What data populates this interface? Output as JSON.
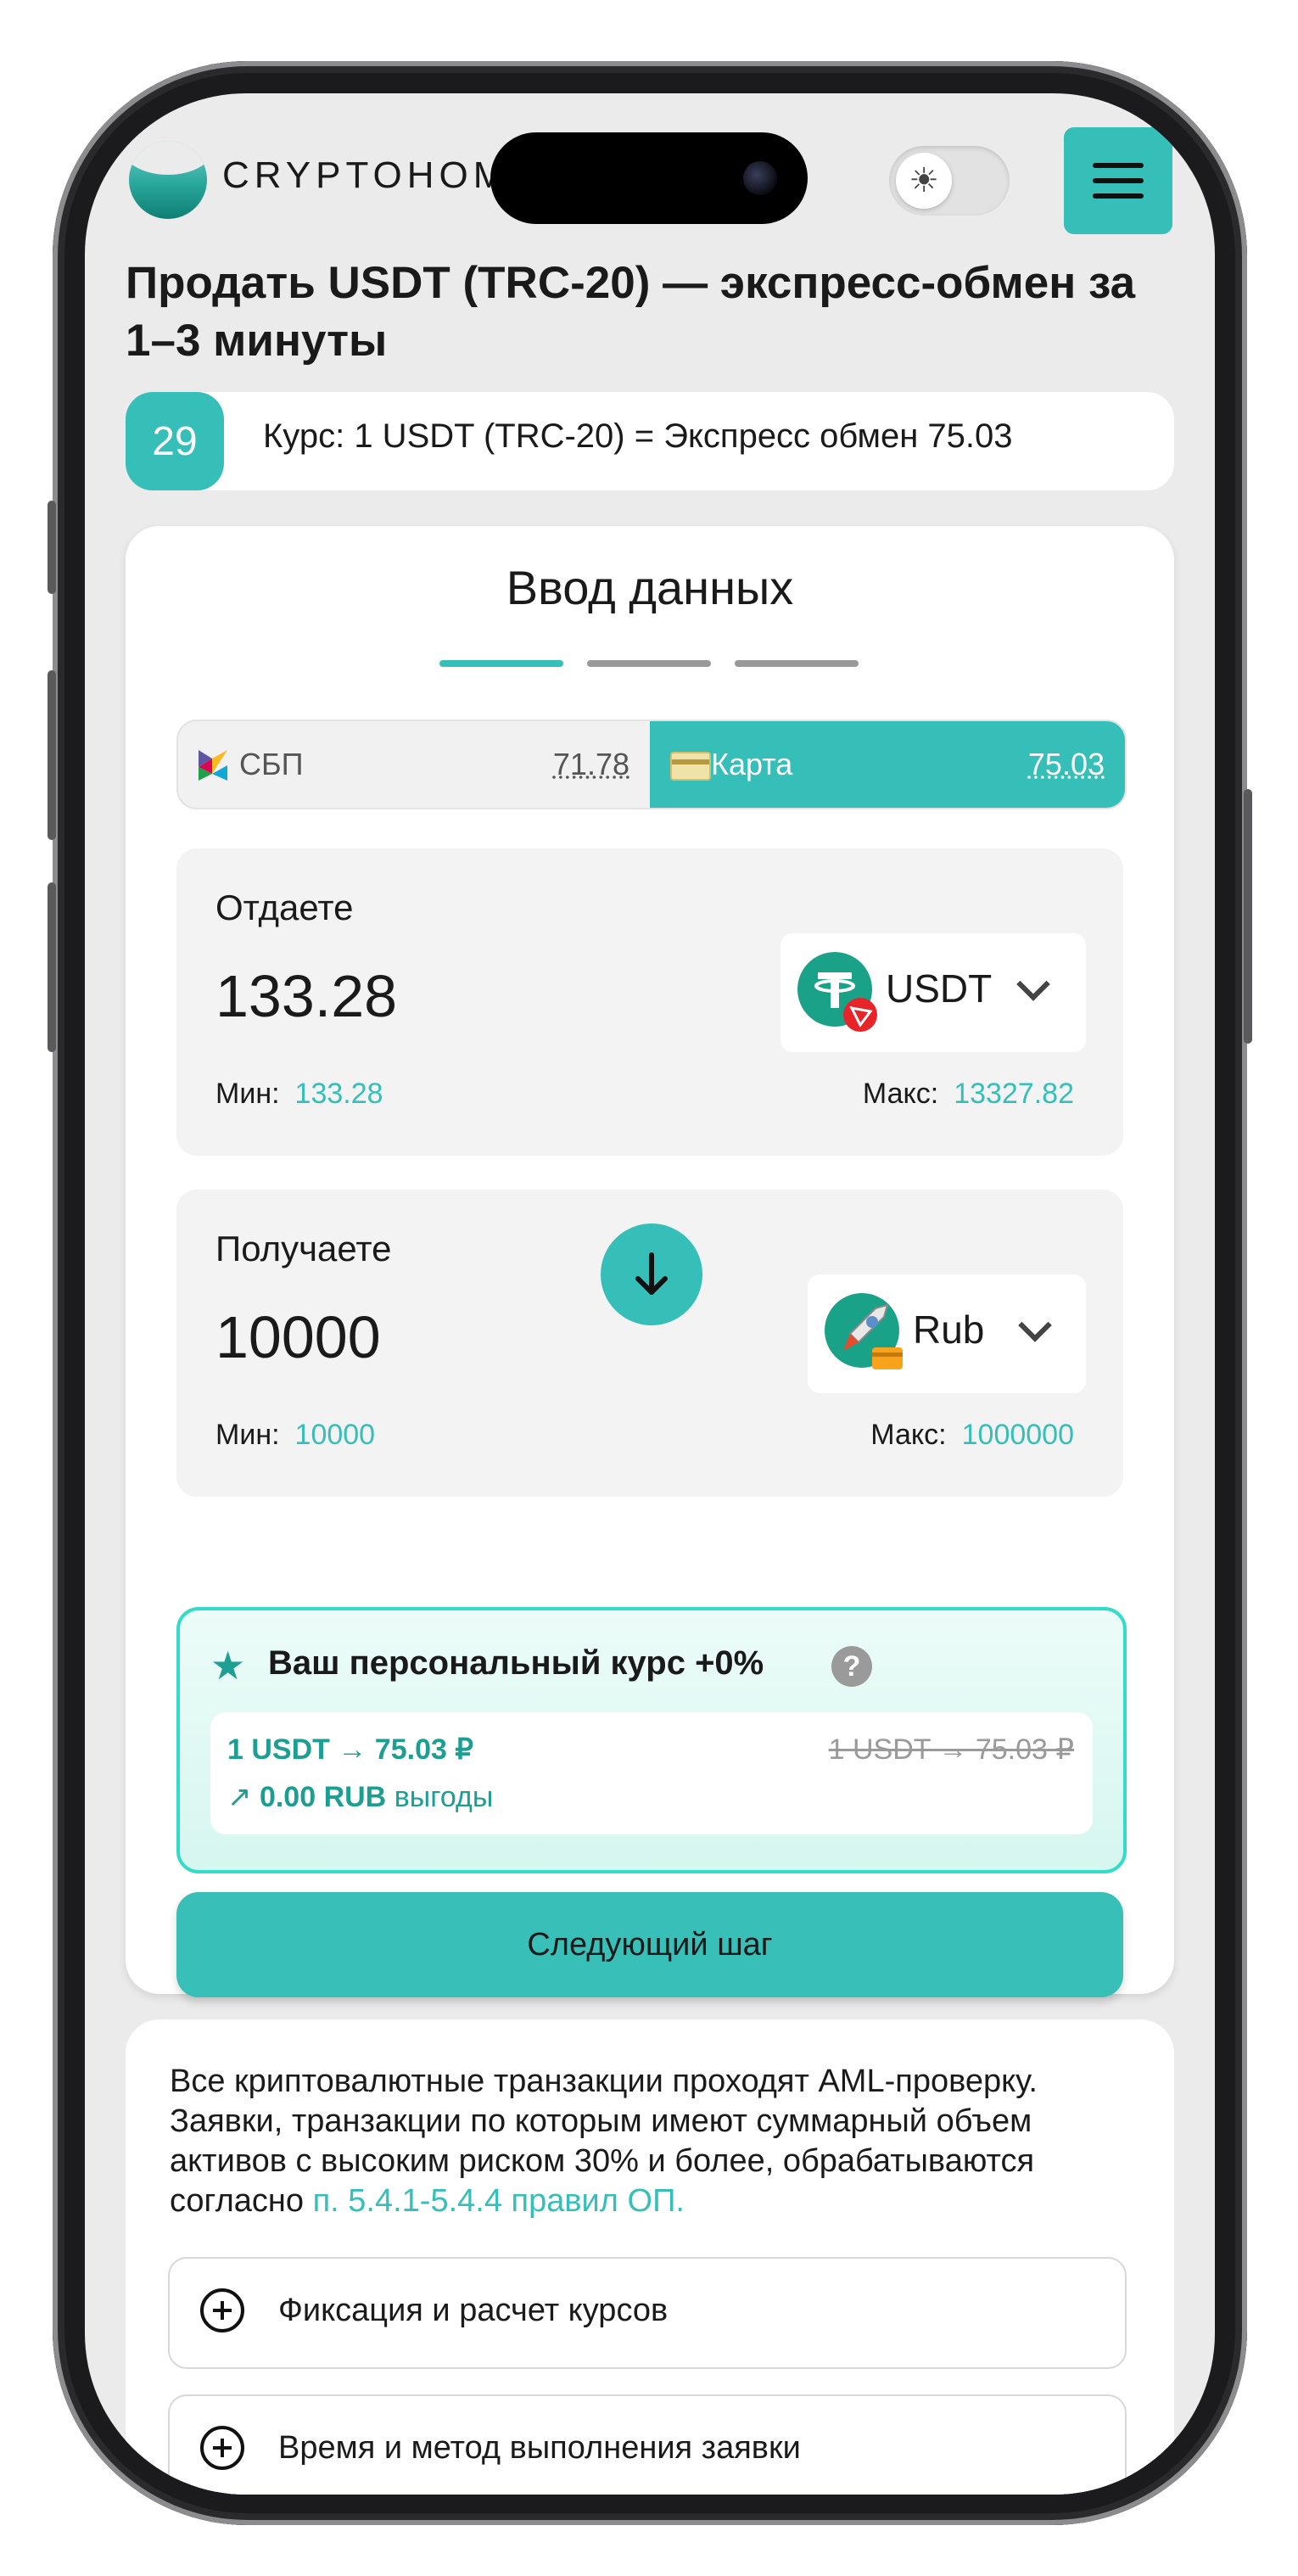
{
  "header": {
    "logo_text": "CRYPTOHOME",
    "theme_icon": "sun-icon",
    "menu_icon": "hamburger-icon"
  },
  "page": {
    "title": "Продать USDT (TRC-20) — экспресс-обмен за 1–3 минуты"
  },
  "rate_bar": {
    "timer": "29",
    "text": "Курс: 1 USDT (TRC-20) = Экспресс обмен 75.03"
  },
  "form": {
    "title": "Ввод данных",
    "steps_total": 3,
    "step_active": 1,
    "methods": [
      {
        "label": "СБП",
        "rate": "71.78",
        "icon": "sbp-icon",
        "selected": false
      },
      {
        "label": "Карта",
        "rate": "75.03",
        "icon": "bank-card-icon",
        "selected": true
      }
    ],
    "give": {
      "label": "Отдаете",
      "amount": "133.28",
      "currency": "USDT",
      "min_label": "Мин:",
      "min": "133.28",
      "max_label": "Макс:",
      "max": "13327.82"
    },
    "get": {
      "label": "Получаете",
      "amount": "10000",
      "currency": "Rub",
      "min_label": "Мин:",
      "min": "10000",
      "max_label": "Макс:",
      "max": "1000000"
    },
    "promo": {
      "title": "Ваш персональный курс +0%",
      "rate": "1 USDT → 75.03 ₽",
      "old_rate": "1 USDT → 75.03 ₽",
      "benefit_amount": "0.00 RUB",
      "benefit_text": "выгоды"
    },
    "next_button": "Следующий шаг"
  },
  "info": {
    "text": "Все криптовалютные транзакции проходят AML-проверку. Заявки, транзакции по которым имеют суммарный объем активов с высоким риском 30% и более, обрабатываются согласно ",
    "link": "п. 5.4.1-5.4.4 правил ОП.",
    "accordions": [
      "Фиксация и расчет курсов",
      "Время и метод выполнения заявки"
    ]
  },
  "colors": {
    "accent": "#35bfb8",
    "background": "#ebebeb",
    "promo_border": "#33dbc9"
  }
}
